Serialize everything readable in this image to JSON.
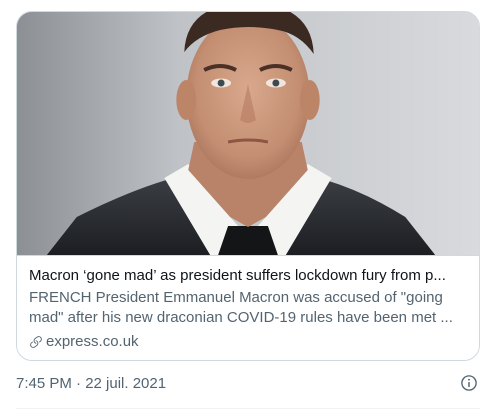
{
  "card": {
    "image_alt": "Emmanuel Macron",
    "title": "Macron ‘gone mad’ as president suffers lockdown fury from p...",
    "description": "FRENCH President Emmanuel Macron was accused of \"going mad\" after his new draconian COVID-19 rules have been met ...",
    "domain": "express.co.uk",
    "link_icon": "link-icon"
  },
  "meta": {
    "timestamp": "7:45 PM · 22 juil. 2021",
    "info_icon": "info-icon"
  },
  "colors": {
    "text_primary": "#0f1419",
    "text_secondary": "#536471",
    "border": "#cfd9de"
  }
}
